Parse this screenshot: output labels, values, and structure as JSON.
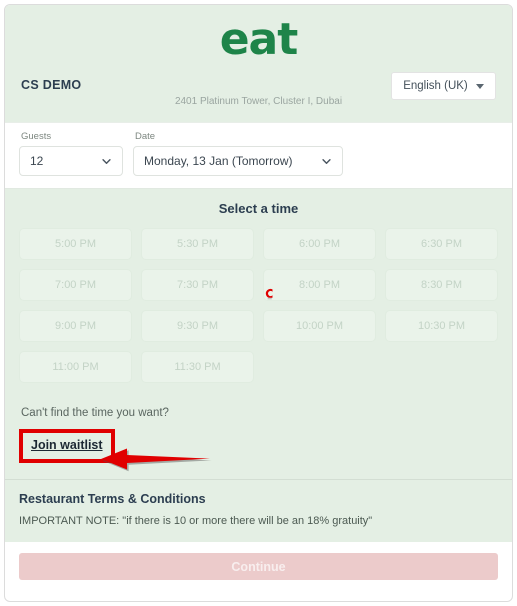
{
  "header": {
    "logo_text": "eat",
    "logo_color": "#1e8449",
    "venue_name": "CS DEMO",
    "venue_address": "2401 Platinum Tower, Cluster I, Dubai",
    "language_selected": "English (UK)",
    "language_caret_icon": "chevron-down-icon"
  },
  "form": {
    "guests_label": "Guests",
    "guests_value": "12",
    "date_label": "Date",
    "date_value": "Monday, 13 Jan (Tomorrow)",
    "chevron_icon": "chevron-down-icon"
  },
  "time": {
    "section_title": "Select a time",
    "slots": [
      "5:00 PM",
      "5:30 PM",
      "6:00 PM",
      "6:30 PM",
      "7:00 PM",
      "7:30 PM",
      "8:00 PM",
      "8:30 PM",
      "9:00 PM",
      "9:30 PM",
      "10:00 PM",
      "10:30 PM",
      "11:00 PM",
      "11:30 PM"
    ],
    "slots_disabled": true
  },
  "waitlist": {
    "question": "Can't find the time you want?",
    "link_label": "Join waitlist",
    "highlight_color": "#e00000"
  },
  "terms": {
    "title": "Restaurant Terms & Conditions",
    "note": "IMPORTANT NOTE: \"if there is 10 or more there will be an 18% gratuity\""
  },
  "footer": {
    "continue_label": "Continue",
    "continue_color": "#eccbcb",
    "continue_disabled": true
  },
  "annotations": {
    "arrow_color": "#e00000",
    "cursor_glyph": "C",
    "cursor_color": "#e00000"
  }
}
